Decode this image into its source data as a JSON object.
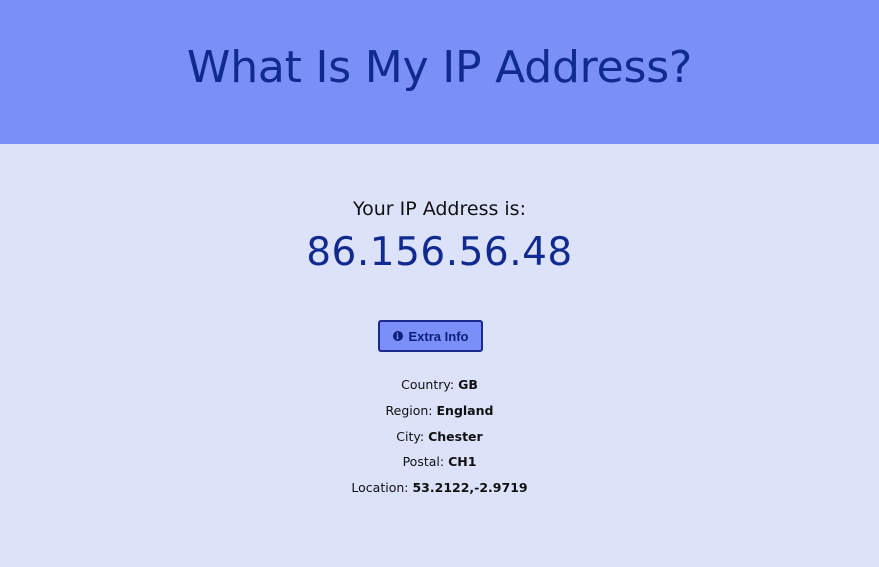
{
  "header": {
    "title": "What Is My IP Address?"
  },
  "main": {
    "ip_label": "Your IP Address is:",
    "ip_value": "86.156.56.48",
    "extra_button": {
      "icon": "info-circle-icon",
      "label": "Extra Info"
    },
    "details": [
      {
        "label": "Country:",
        "value": "GB"
      },
      {
        "label": "Region:",
        "value": "England"
      },
      {
        "label": "City:",
        "value": "Chester"
      },
      {
        "label": "Postal:",
        "value": "CH1"
      },
      {
        "label": "Location:",
        "value": "53.2122,-2.9719"
      }
    ]
  },
  "colors": {
    "header_bg": "#7b8ff8",
    "page_bg": "#dde2fb",
    "accent": "#102a8f"
  }
}
